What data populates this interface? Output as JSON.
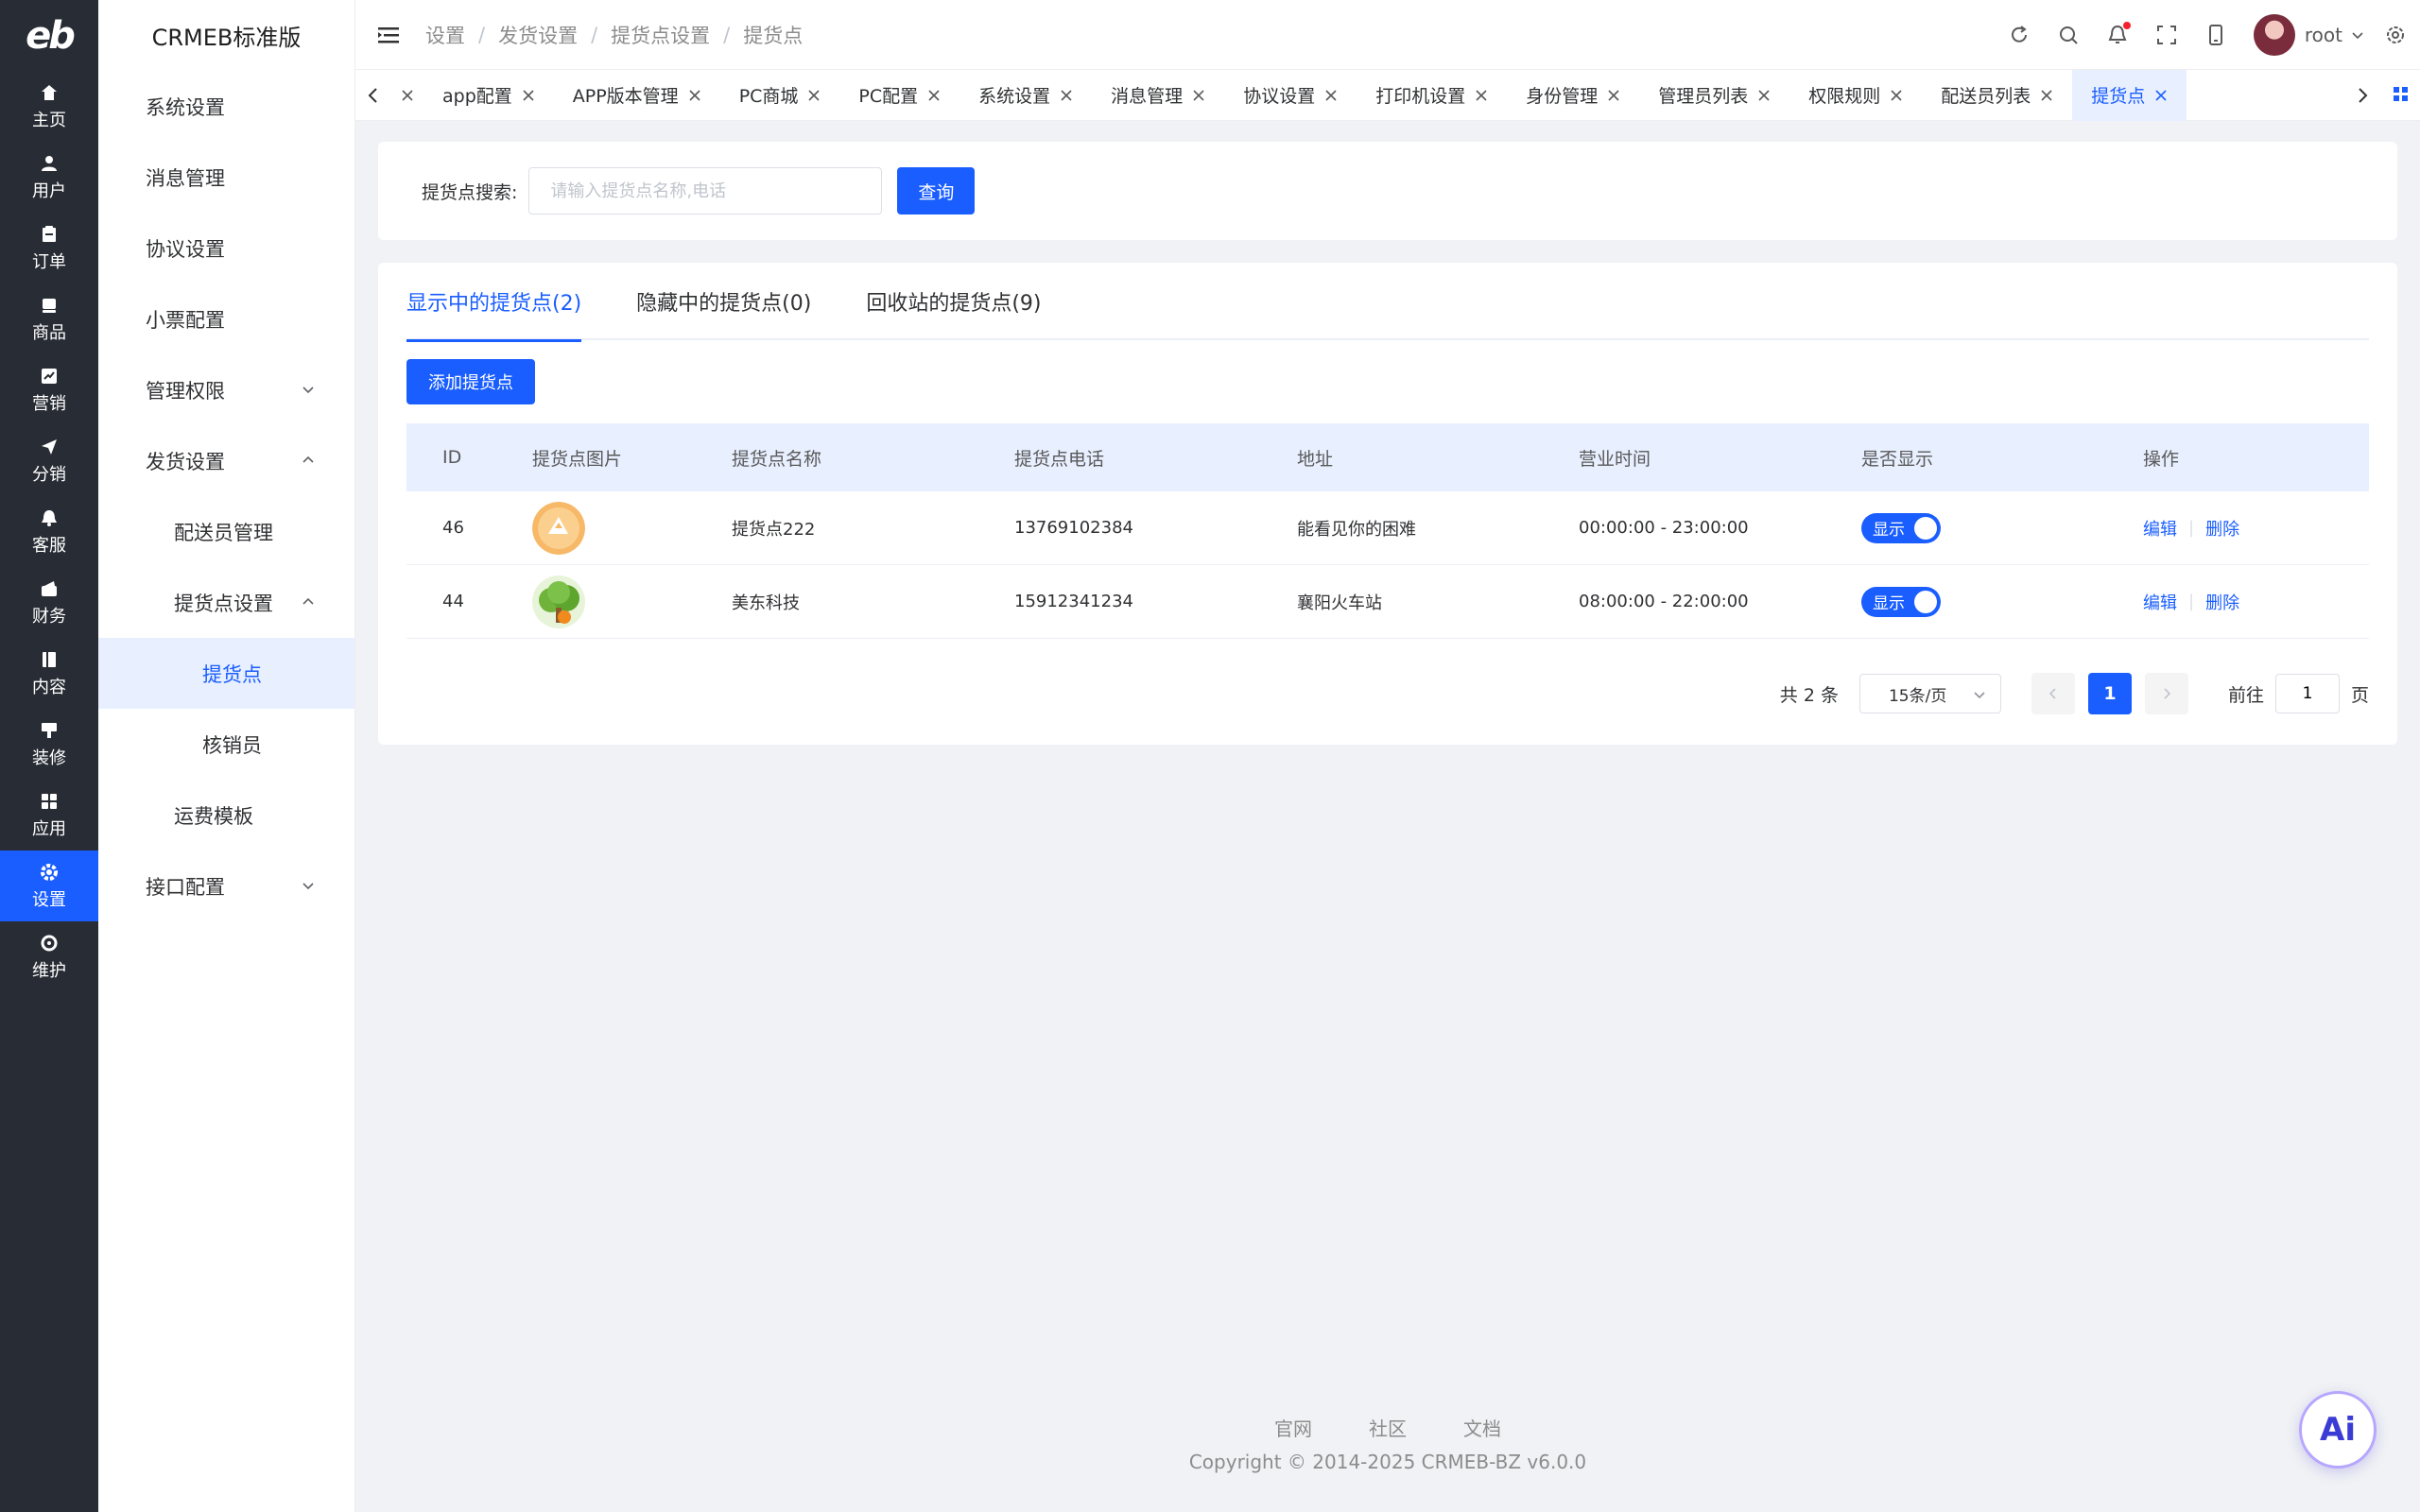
{
  "rail": {
    "logo": "eb",
    "items": [
      {
        "label": "主页",
        "icon": "home-icon"
      },
      {
        "label": "用户",
        "icon": "user-icon"
      },
      {
        "label": "订单",
        "icon": "order-icon"
      },
      {
        "label": "商品",
        "icon": "product-icon"
      },
      {
        "label": "营销",
        "icon": "marketing-icon"
      },
      {
        "label": "分销",
        "icon": "distribution-icon"
      },
      {
        "label": "客服",
        "icon": "service-icon"
      },
      {
        "label": "财务",
        "icon": "finance-icon"
      },
      {
        "label": "内容",
        "icon": "content-icon"
      },
      {
        "label": "装修",
        "icon": "decoration-icon"
      },
      {
        "label": "应用",
        "icon": "apps-icon"
      },
      {
        "label": "设置",
        "icon": "settings-icon",
        "active": true
      },
      {
        "label": "维护",
        "icon": "maintenance-icon"
      }
    ]
  },
  "menu": {
    "brand": "CRMEB标准版",
    "items": [
      {
        "label": "系统设置"
      },
      {
        "label": "消息管理"
      },
      {
        "label": "协议设置"
      },
      {
        "label": "小票配置"
      },
      {
        "label": "管理权限"
      },
      {
        "label": "发货设置"
      },
      {
        "label": "配送员管理"
      },
      {
        "label": "提货点设置"
      },
      {
        "label": "提货点",
        "active": true
      },
      {
        "label": "核销员"
      },
      {
        "label": "运费模板"
      },
      {
        "label": "接口配置"
      }
    ]
  },
  "breadcrumb": [
    "设置",
    "发货设置",
    "提货点设置",
    "提货点"
  ],
  "header": {
    "username": "root"
  },
  "tabs": [
    "app配置",
    "APP版本管理",
    "PC商城",
    "PC配置",
    "系统设置",
    "消息管理",
    "协议设置",
    "打印机设置",
    "身份管理",
    "管理员列表",
    "权限规则",
    "配送员列表",
    "提货点"
  ],
  "search": {
    "label": "提货点搜索:",
    "placeholder": "请输入提货点名称,电话",
    "value": "",
    "button": "查询"
  },
  "subtabs": [
    "显示中的提货点(2)",
    "隐藏中的提货点(0)",
    "回收站的提货点(9)"
  ],
  "add_button": "添加提货点",
  "table": {
    "headers": [
      "ID",
      "提货点图片",
      "提货点名称",
      "提货点电话",
      "地址",
      "营业时间",
      "是否显示",
      "操作"
    ],
    "rows": [
      {
        "id": "46",
        "name": "提货点222",
        "phone": "13769102384",
        "address": "能看见你的困难",
        "hours": "00:00:00 - 23:00:00",
        "show": "显示",
        "edit": "编辑",
        "delete": "删除"
      },
      {
        "id": "44",
        "name": "美东科技",
        "phone": "15912341234",
        "address": "襄阳火车站",
        "hours": "08:00:00 - 22:00:00",
        "show": "显示",
        "edit": "编辑",
        "delete": "删除"
      }
    ]
  },
  "pagination": {
    "total": "共 2 条",
    "page_size": "15条/页",
    "current": "1",
    "goto_label": "前往",
    "goto_value": "1",
    "page_suffix": "页"
  },
  "footer": {
    "links": [
      "官网",
      "社区",
      "文档"
    ],
    "copyright": "Copyright © 2014-2025 CRMEB-BZ v6.0.0"
  },
  "ai_badge": "Ai",
  "colors": {
    "primary": "#1a5eff",
    "rail_bg": "#282c34",
    "page_bg": "#f0f2f5"
  }
}
